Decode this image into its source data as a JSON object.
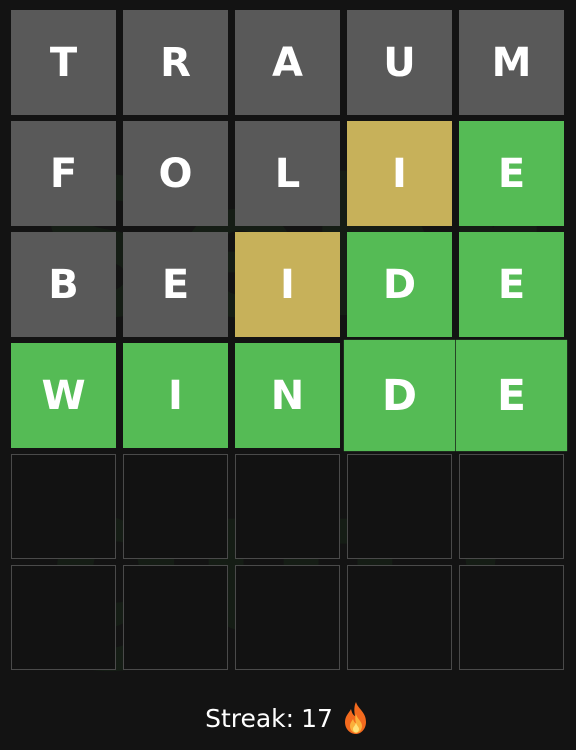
{
  "watermark": {
    "line1": "Sehr",
    "line2": "gut!"
  },
  "board": {
    "rows": [
      {
        "tiles": [
          {
            "letter": "T",
            "state": "absent"
          },
          {
            "letter": "R",
            "state": "absent"
          },
          {
            "letter": "A",
            "state": "absent"
          },
          {
            "letter": "U",
            "state": "absent"
          },
          {
            "letter": "M",
            "state": "absent"
          }
        ]
      },
      {
        "tiles": [
          {
            "letter": "F",
            "state": "absent"
          },
          {
            "letter": "O",
            "state": "absent"
          },
          {
            "letter": "L",
            "state": "absent"
          },
          {
            "letter": "I",
            "state": "present"
          },
          {
            "letter": "E",
            "state": "correct"
          }
        ]
      },
      {
        "tiles": [
          {
            "letter": "B",
            "state": "absent"
          },
          {
            "letter": "E",
            "state": "absent"
          },
          {
            "letter": "I",
            "state": "present"
          },
          {
            "letter": "D",
            "state": "correct"
          },
          {
            "letter": "E",
            "state": "correct"
          }
        ]
      },
      {
        "tiles": [
          {
            "letter": "W",
            "state": "correct"
          },
          {
            "letter": "I",
            "state": "correct"
          },
          {
            "letter": "N",
            "state": "correct"
          },
          {
            "letter": "D",
            "state": "correct"
          },
          {
            "letter": "E",
            "state": "correct"
          }
        ]
      },
      {
        "tiles": [
          {
            "letter": "",
            "state": "empty"
          },
          {
            "letter": "",
            "state": "empty"
          },
          {
            "letter": "",
            "state": "empty"
          },
          {
            "letter": "",
            "state": "empty"
          },
          {
            "letter": "",
            "state": "empty"
          }
        ]
      },
      {
        "tiles": [
          {
            "letter": "",
            "state": "empty"
          },
          {
            "letter": "",
            "state": "empty"
          },
          {
            "letter": "",
            "state": "empty"
          },
          {
            "letter": "",
            "state": "empty"
          },
          {
            "letter": "",
            "state": "empty"
          }
        ]
      }
    ]
  },
  "footer": {
    "streak_label": "Streak:",
    "streak_value": "17",
    "icon": "fire-icon"
  },
  "colors": {
    "absent": "#595959",
    "present": "#c7b15a",
    "correct": "#55bb55",
    "empty": "#121212",
    "background": "#131313"
  }
}
